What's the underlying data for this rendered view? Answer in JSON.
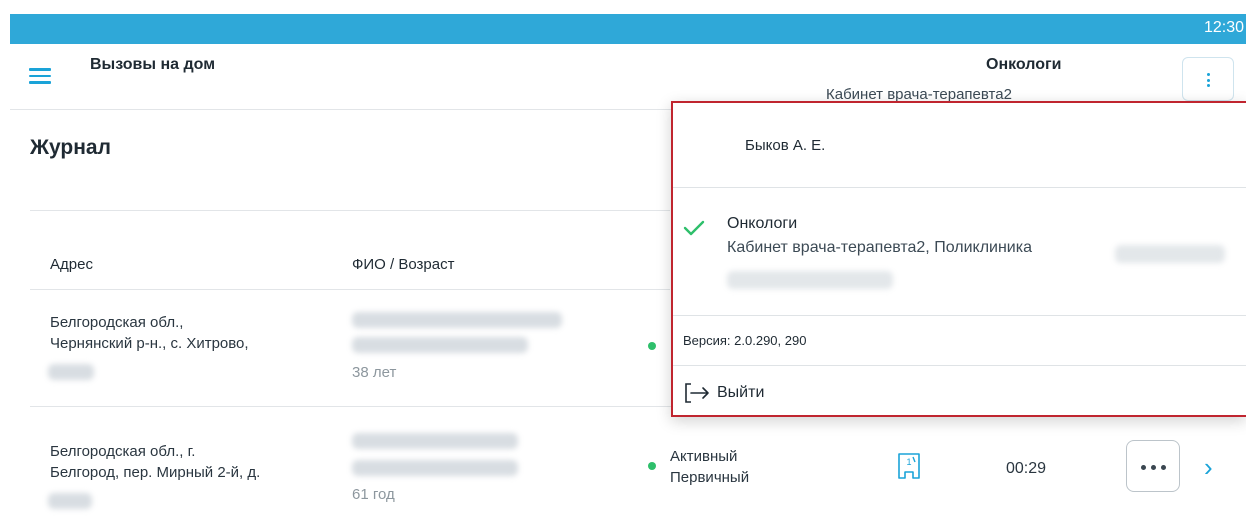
{
  "status_bar": {
    "time": "12:30"
  },
  "app_bar": {
    "title": "Вызовы на дом",
    "department": "Онкологи",
    "cabinet": "Кабинет врача-терапевта2"
  },
  "page": {
    "title": "Журнал"
  },
  "table": {
    "columns": [
      "Адрес",
      "ФИО / Возраст"
    ],
    "rows": [
      {
        "address_line1": "Белгородская обл.,",
        "address_line2": "Чернянский р-н., с. Хитрово,",
        "age": "38 лет"
      },
      {
        "address_line1": "Белгородская обл., г.",
        "address_line2": "Белгород, пер. Мирный 2-й, д.",
        "age": "61 год",
        "status_line1": "Активный",
        "status_line2": "Первичный",
        "duration": "00:29"
      }
    ]
  },
  "user_menu": {
    "user_name": "Быков А. Е.",
    "org_name": "Онкологи",
    "org_description": "Кабинет врача-терапевта2, Поликлиника",
    "version": "Версия: 2.0.290, 290",
    "logout_label": "Выйти"
  },
  "colors": {
    "status_bar": "#2fa8d8",
    "accent": "#1aa3d8",
    "check": "#2ebf6b",
    "popup_border": "#c0252f"
  },
  "icons": [
    "hamburger-icon",
    "more-vertical-icon",
    "check-icon",
    "logout-icon",
    "document-icon",
    "more-horizontal-icon",
    "chevron-right-icon"
  ]
}
